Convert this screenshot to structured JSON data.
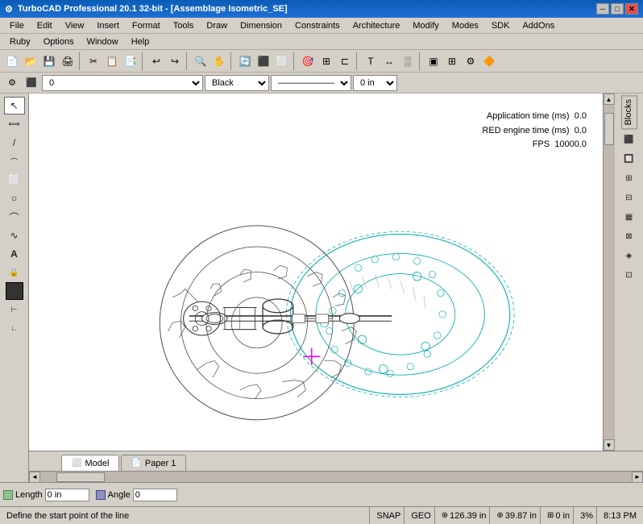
{
  "titlebar": {
    "title": "TurboCAD Professional 20.1 32-bit - [Assemblage Isometric_SE]",
    "icon": "⚙",
    "min_btn": "─",
    "max_btn": "□",
    "close_btn": "✕",
    "child_min": "─",
    "child_max": "□",
    "child_close": "✕"
  },
  "menus": {
    "items": [
      "File",
      "Edit",
      "View",
      "Insert",
      "Format",
      "Tools",
      "Draw",
      "Dimension",
      "Constraints",
      "Architecture",
      "Modify",
      "Modes",
      "SDK",
      "AddOns"
    ]
  },
  "menus2": {
    "items": [
      "Ruby",
      "Options",
      "Window",
      "Help"
    ]
  },
  "toolbar1": {
    "buttons": [
      "📄",
      "📂",
      "💾",
      "🖨",
      "🔍",
      "✂",
      "📋",
      "📑",
      "🗑",
      "↩",
      "↪",
      "🔍",
      "💬",
      "📐",
      "📏",
      "🔄",
      "⬛",
      "⬜",
      "⬛",
      "🔷",
      "⬛",
      "🖊",
      "📝",
      "🔒",
      "🔓",
      "📦",
      "📊",
      "🔤",
      "🔧",
      "🔨"
    ]
  },
  "toolbar2": {
    "layer_value": "0",
    "color_value": "Black",
    "linetype_value": "————————",
    "linewidth_value": "0 in"
  },
  "left_tools": {
    "tools": [
      "↖",
      "↕",
      "↙",
      "⟋",
      "⬜",
      "○",
      "⌒",
      "∿",
      "А",
      "🔒",
      "⬛",
      "🔢",
      "∟"
    ]
  },
  "right_panel": {
    "label": "Blocks",
    "buttons": [
      "⬛",
      "⬛",
      "⬛",
      "⬛",
      "⬛",
      "⬛",
      "⬛",
      "⬛",
      "⬛"
    ]
  },
  "stats": {
    "app_time_label": "Application time (ms)",
    "app_time_value": "0.0",
    "red_engine_label": "RED engine time (ms)",
    "red_engine_value": "0.0",
    "fps_label": "FPS",
    "fps_value": "10000.0"
  },
  "tabs": {
    "model_label": "Model",
    "paper1_label": "Paper 1"
  },
  "coord_bar": {
    "length_label": "Length",
    "angle_label": "Angle",
    "length_value": "0 in",
    "angle_value": "0"
  },
  "status_bar": {
    "message": "Define the start point of the line",
    "snap": "SNAP",
    "geo": "GEO",
    "x_value": "126.39 in",
    "y_value": "39.87 in",
    "z_value": "0 in",
    "zoom": "3%",
    "time": "8:13 PM"
  }
}
